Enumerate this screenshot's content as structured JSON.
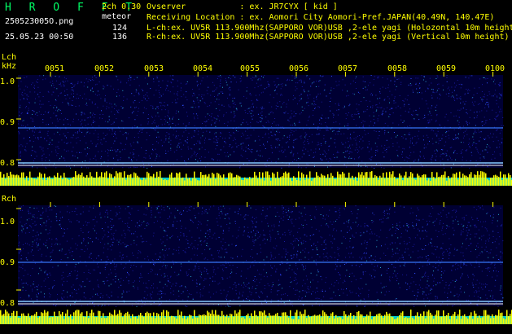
{
  "header": {
    "title": "H R O F F T",
    "version": "2ch 0.30",
    "filename": "250523005O.png",
    "mode": "meteor",
    "datetime": "25.05.23 00:50",
    "count_l": "124",
    "count_r": "136"
  },
  "info": {
    "observer": "Ovserver           : ex. JR7CYX [ kid ]",
    "location": "Receiving Location : ex. Aomori City Aomori-Pref.JAPAN(40.49N, 140.47E)",
    "lch": "L-ch:ex. UV5R 113.900Mhz(SAPPORO VOR)USB ,2-ele yagi (Holozontal 10m height)",
    "rch": "R-ch:ex. UV5R 113.900Mhz(SAPPORO VOR)USB ,2-ele yagi (Vertical 10m height)"
  },
  "lch_panel": {
    "label": "Lch",
    "unit": "kHz",
    "ticks": [
      "1.0",
      "0.9",
      "0.8"
    ]
  },
  "rch_panel": {
    "label": "Rch",
    "ticks": [
      "1.0",
      "0.9",
      "0.8"
    ]
  },
  "time_labels": [
    "0051",
    "0052",
    "0053",
    "0054",
    "0055",
    "0056",
    "0057",
    "0058",
    "0059",
    "0100"
  ],
  "colors": {
    "accent": "#ffff00",
    "title": "#00ff66",
    "waterfall_bg": "#000033",
    "signal": "#00ffff"
  }
}
